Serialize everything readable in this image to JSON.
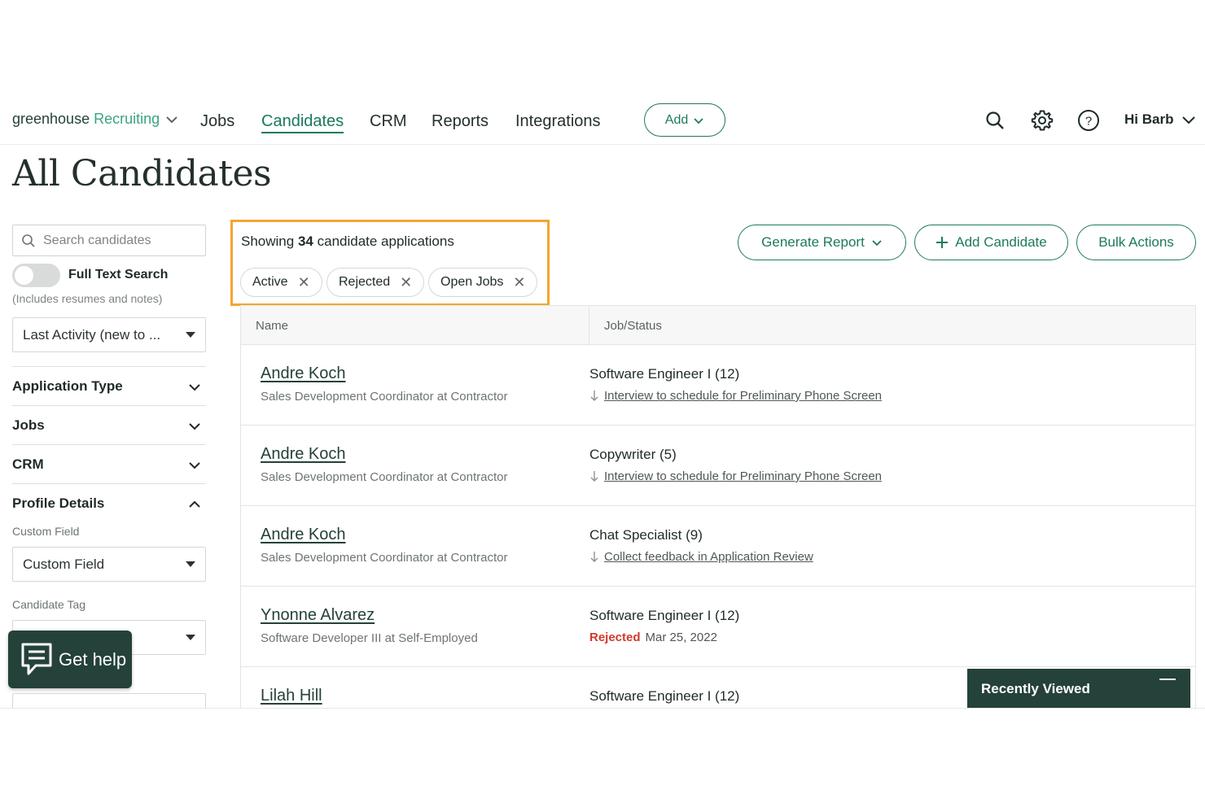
{
  "nav": {
    "logo_main": "greenhouse",
    "logo_sub": "Recruiting",
    "links": [
      "Jobs",
      "Candidates",
      "CRM",
      "Reports",
      "Integrations"
    ],
    "add_label": "Add",
    "user_label": "Hi Barb",
    "icons": [
      "search-icon",
      "gear-icon",
      "help-icon"
    ]
  },
  "page_title": "All Candidates",
  "sidebar": {
    "search_placeholder": "Search candidates",
    "full_text_label": "Full Text Search",
    "full_text_sub": "(Includes resumes and notes)",
    "sort_value": "Last Activity (new to ...",
    "facets": [
      "Application Type",
      "Jobs",
      "CRM",
      "Profile Details"
    ],
    "custom_field_label": "Custom Field",
    "custom_field_value": "Custom Field",
    "candidate_tag_label": "Candidate Tag"
  },
  "summary": {
    "prefix": "Showing",
    "count": "34",
    "suffix": "candidate applications",
    "chips": [
      "Active",
      "Rejected",
      "Open Jobs"
    ]
  },
  "actions": {
    "generate_report": "Generate Report",
    "add_candidate": "Add Candidate",
    "bulk_actions": "Bulk Actions"
  },
  "table": {
    "headers": [
      "Name",
      "Job/Status"
    ],
    "rows": [
      {
        "name": "Andre Koch",
        "sub": "Sales Development Coordinator at Contractor",
        "job": "Software Engineer I (12)",
        "status": "Interview to schedule for Preliminary Phone Screen",
        "rejected": "",
        "date": ""
      },
      {
        "name": "Andre Koch",
        "sub": "Sales Development Coordinator at Contractor",
        "job": "Copywriter (5)",
        "status": "Interview to schedule for Preliminary Phone Screen",
        "rejected": "",
        "date": ""
      },
      {
        "name": "Andre Koch",
        "sub": "Sales Development Coordinator at Contractor",
        "job": "Chat Specialist (9)",
        "status": "Collect feedback in Application Review",
        "rejected": "",
        "date": ""
      },
      {
        "name": "Ynonne Alvarez",
        "sub": "Software Developer III at Self-Employed",
        "job": "Software Engineer I (12)",
        "status": "",
        "rejected": "Rejected",
        "date": "Mar 25, 2022"
      },
      {
        "name": "Lilah Hill",
        "sub": "",
        "job": "Software Engineer I (12)",
        "status": "",
        "rejected": "",
        "date": ""
      }
    ]
  },
  "get_help": "Get help",
  "recently_viewed": "Recently Viewed",
  "colors": {
    "brand_green": "#177a5d",
    "dark_green": "#24413a",
    "highlight_orange": "#f5a530",
    "rejected_red": "#d03a2a"
  }
}
